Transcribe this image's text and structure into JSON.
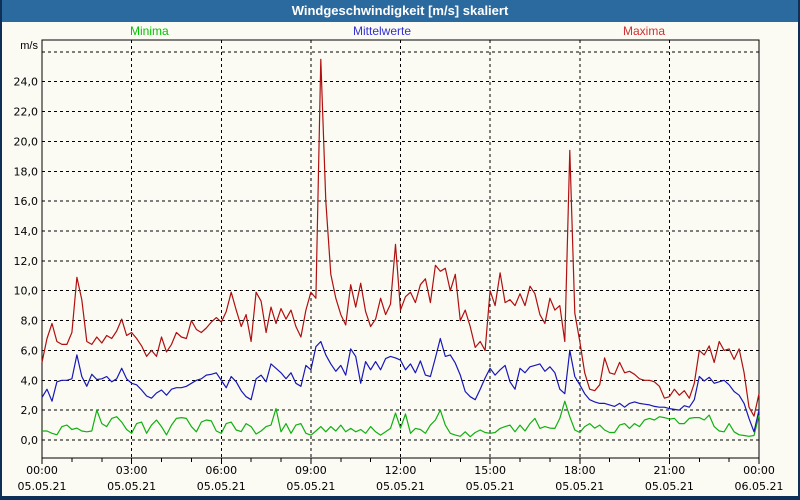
{
  "window": {
    "title": "Windgeschwindigkeit [m/s] skaliert"
  },
  "legend": {
    "minima": {
      "label": "Minima",
      "color": "#00c400"
    },
    "mittelwerte": {
      "label": "Mittelwerte",
      "color": "#3030d0"
    },
    "maxima": {
      "label": "Maxima",
      "color": "#d03030"
    }
  },
  "chart_data": {
    "type": "line",
    "title": "Windgeschwindigkeit [m/s] skaliert",
    "ylabel": "m/s",
    "ylim": [
      -1.2,
      26.9
    ],
    "ytick_step": 2,
    "grid_max_value": 26,
    "yticks": [
      "0,0",
      "2,0",
      "4,0",
      "6,0",
      "8,0",
      "10,0",
      "12,0",
      "14,0",
      "16,0",
      "18,0",
      "20,0",
      "22,0",
      "24,0"
    ],
    "x_hours_range": [
      0,
      24
    ],
    "x_major_step_hours": 3,
    "x_minor_step_hours": 1,
    "grid": true,
    "legend_position": "top",
    "sample_interval_minutes": 10,
    "xticks": [
      {
        "time": "00:00",
        "date": "05.05.21"
      },
      {
        "time": "03:00",
        "date": "05.05.21"
      },
      {
        "time": "06:00",
        "date": "05.05.21"
      },
      {
        "time": "09:00",
        "date": "05.05.21"
      },
      {
        "time": "12:00",
        "date": "05.05.21"
      },
      {
        "time": "15:00",
        "date": "05.05.21"
      },
      {
        "time": "18:00",
        "date": "05.05.21"
      },
      {
        "time": "21:00",
        "date": "05.05.21"
      },
      {
        "time": "00:00",
        "date": "06.05.21"
      }
    ],
    "series": [
      {
        "name": "Minima",
        "color": "#10b010",
        "values": [
          0.6,
          0.6,
          0.45,
          0.35,
          0.9,
          1.0,
          0.7,
          0.8,
          0.6,
          0.55,
          0.6,
          2.0,
          1.1,
          0.9,
          1.45,
          1.56,
          1.2,
          0.7,
          0.45,
          1.1,
          1.2,
          0.45,
          1.0,
          1.34,
          0.9,
          0.34,
          1.0,
          1.45,
          1.5,
          1.45,
          0.9,
          0.55,
          1.2,
          1.34,
          1.28,
          0.6,
          0.45,
          1.1,
          1.2,
          0.67,
          0.56,
          1.1,
          0.9,
          0.4,
          0.6,
          0.9,
          1.0,
          2.1,
          0.55,
          1.1,
          0.45,
          1.0,
          1.1,
          0.45,
          0.33,
          0.6,
          0.9,
          0.55,
          0.9,
          0.6,
          1.0,
          0.55,
          0.78,
          0.55,
          0.7,
          0.45,
          0.9,
          0.55,
          0.33,
          0.55,
          0.78,
          1.8,
          0.8,
          1.74,
          0.45,
          0.78,
          0.7,
          0.45,
          1.0,
          1.34,
          2.0,
          1.0,
          0.45,
          0.33,
          0.25,
          0.55,
          0.22,
          0.5,
          0.67,
          0.5,
          0.45,
          0.5,
          0.78,
          0.9,
          1.0,
          0.55,
          1.0,
          0.6,
          1.1,
          1.45,
          0.78,
          0.9,
          0.8,
          0.78,
          1.45,
          2.6,
          1.56,
          0.67,
          0.5,
          0.9,
          1.1,
          0.8,
          1.0,
          0.67,
          0.5,
          0.5,
          1.0,
          1.1,
          0.78,
          1.1,
          0.9,
          1.34,
          1.45,
          1.34,
          1.56,
          1.5,
          1.4,
          1.45,
          1.1,
          1.1,
          1.45,
          1.5,
          1.5,
          1.34,
          1.67,
          0.9,
          0.6,
          0.55,
          1.1,
          0.55,
          0.35,
          0.3,
          0.25,
          0.3,
          1.65
        ]
      },
      {
        "name": "Mittelwerte",
        "color": "#1818b8",
        "values": [
          2.85,
          3.4,
          2.6,
          3.9,
          4.0,
          4.0,
          4.1,
          5.7,
          4.25,
          3.6,
          4.4,
          4.05,
          4.1,
          4.25,
          3.9,
          4.1,
          4.8,
          4.1,
          3.8,
          3.7,
          3.35,
          2.95,
          2.8,
          3.15,
          3.35,
          3.0,
          3.4,
          3.5,
          3.5,
          3.6,
          3.8,
          4.0,
          4.1,
          4.35,
          4.4,
          4.5,
          4.0,
          3.5,
          4.25,
          3.9,
          3.3,
          2.9,
          2.7,
          4.1,
          4.35,
          3.9,
          5.1,
          4.8,
          4.5,
          4.1,
          4.5,
          3.8,
          3.6,
          5.0,
          4.7,
          6.25,
          6.6,
          5.7,
          5.1,
          4.6,
          5.0,
          4.35,
          6.1,
          5.6,
          3.8,
          5.25,
          4.7,
          5.25,
          4.7,
          5.45,
          5.6,
          5.5,
          5.35,
          4.7,
          5.1,
          4.5,
          5.3,
          4.35,
          4.25,
          5.5,
          6.8,
          5.6,
          5.7,
          5.15,
          4.35,
          3.25,
          2.9,
          2.7,
          3.4,
          4.15,
          4.8,
          4.35,
          4.7,
          5.0,
          3.9,
          3.4,
          4.8,
          4.5,
          4.9,
          5.0,
          5.1,
          4.6,
          4.9,
          4.5,
          3.4,
          3.1,
          6.0,
          4.25,
          3.7,
          3.1,
          2.7,
          2.55,
          2.45,
          2.45,
          2.35,
          2.25,
          2.45,
          2.2,
          2.45,
          2.55,
          2.45,
          2.4,
          2.35,
          2.25,
          2.2,
          2.2,
          2.1,
          2.05,
          2.0,
          2.3,
          2.2,
          2.7,
          4.25,
          3.95,
          4.2,
          3.8,
          3.9,
          4.0,
          3.7,
          3.25,
          3.0,
          2.45,
          1.45,
          0.55,
          2.0
        ]
      },
      {
        "name": "Maxima",
        "color": "#b01010",
        "values": [
          5.2,
          6.8,
          7.8,
          6.6,
          6.4,
          6.4,
          7.2,
          10.9,
          9.4,
          6.6,
          6.4,
          6.9,
          6.5,
          7.0,
          6.8,
          7.3,
          8.1,
          7.0,
          7.2,
          6.8,
          6.3,
          5.6,
          6.0,
          5.6,
          6.9,
          5.9,
          6.4,
          7.2,
          6.9,
          6.8,
          8.0,
          7.4,
          7.2,
          7.5,
          7.9,
          8.2,
          7.9,
          8.6,
          9.9,
          8.7,
          7.6,
          8.4,
          6.6,
          9.9,
          9.3,
          7.2,
          8.9,
          7.8,
          8.8,
          8.1,
          8.7,
          7.6,
          6.9,
          8.7,
          9.9,
          9.5,
          25.5,
          16.0,
          11.1,
          9.5,
          8.4,
          7.7,
          10.4,
          8.9,
          10.5,
          8.6,
          7.6,
          8.1,
          9.5,
          8.4,
          9.1,
          13.1,
          8.7,
          9.6,
          9.9,
          9.2,
          10.4,
          10.8,
          9.2,
          11.7,
          11.3,
          11.5,
          10.0,
          11.1,
          8.0,
          8.7,
          7.6,
          6.2,
          6.6,
          6.0,
          10.0,
          9.0,
          11.2,
          9.2,
          9.4,
          9.0,
          9.8,
          9.0,
          10.3,
          9.8,
          8.4,
          7.8,
          9.5,
          8.7,
          9.0,
          6.6,
          19.4,
          8.5,
          6.6,
          4.5,
          3.4,
          3.3,
          3.7,
          5.5,
          4.5,
          4.4,
          5.2,
          4.5,
          4.6,
          4.4,
          4.1,
          4.0,
          4.0,
          3.9,
          3.6,
          2.8,
          2.9,
          3.4,
          3.0,
          3.3,
          2.8,
          3.8,
          6.0,
          5.7,
          6.3,
          5.2,
          6.6,
          6.0,
          6.1,
          5.4,
          6.1,
          4.5,
          2.2,
          1.6,
          3.1
        ]
      }
    ]
  }
}
